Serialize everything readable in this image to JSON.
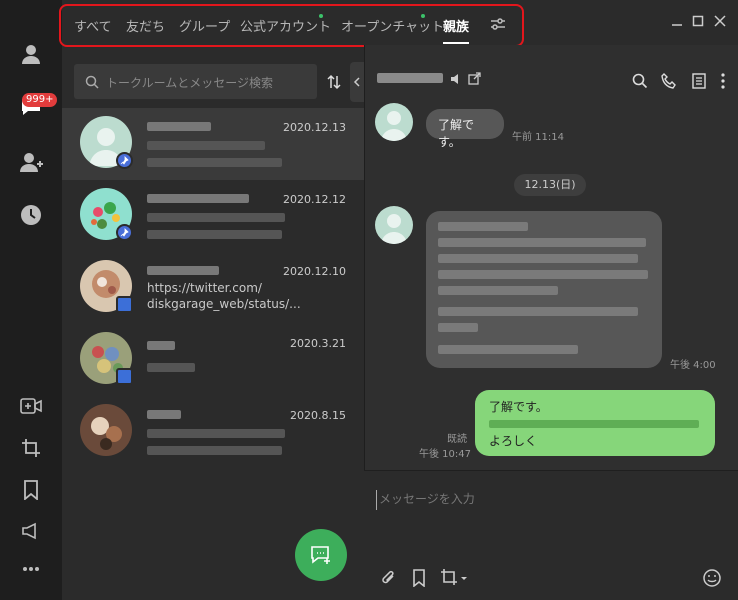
{
  "rail": {
    "badge": "999+"
  },
  "tabs": [
    {
      "label": "すべて",
      "active": false,
      "dot": false
    },
    {
      "label": "友だち",
      "active": false,
      "dot": false
    },
    {
      "label": "グループ",
      "active": false,
      "dot": false
    },
    {
      "label": "公式アカウント",
      "active": false,
      "dot": true
    },
    {
      "label": "オープンチャット",
      "active": false,
      "dot": true
    },
    {
      "label": "親族",
      "active": true,
      "dot": false
    }
  ],
  "search": {
    "placeholder": "トークルームとメッセージ検索"
  },
  "chats": [
    {
      "date": "2020.12.13",
      "pinned": true,
      "snippet": ""
    },
    {
      "date": "2020.12.12",
      "pinned": true,
      "snippet": ""
    },
    {
      "date": "2020.12.10",
      "pinned": false,
      "snippet": "https://twitter.com/",
      "snippet2": "diskgarage_web/status/..."
    },
    {
      "date": "2020.3.21",
      "pinned": false,
      "snippet": ""
    },
    {
      "date": "2020.8.15",
      "pinned": false,
      "snippet": ""
    }
  ],
  "conversation": {
    "msg1": {
      "text": "了解です。",
      "time": "午前 11:14"
    },
    "date_separator": "12.13(日)",
    "msg2": {
      "time": "午後 4:00"
    },
    "msg3": {
      "line1": "了解です。",
      "line3": "よろしく",
      "read": "既読",
      "time": "午後 10:47"
    },
    "input_placeholder": "メッセージを入力"
  },
  "colors": {
    "accent_green": "#3dae5b",
    "bubble_green": "#86d67a",
    "badge_red": "#e23c3c",
    "highlight_red": "#e3161c"
  }
}
